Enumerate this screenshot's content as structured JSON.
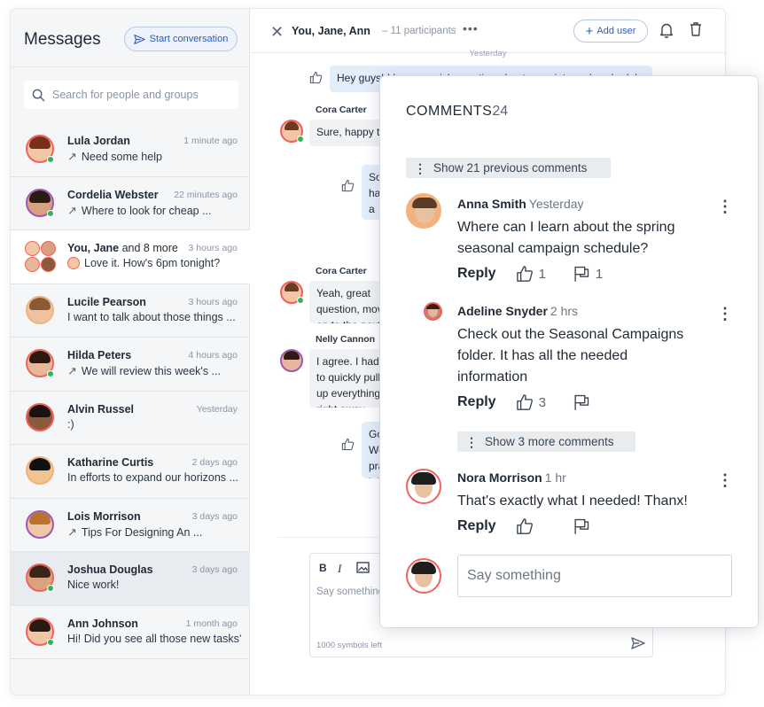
{
  "sidebar": {
    "title": "Messages",
    "start_button": "Start conversation",
    "search_placeholder": "Search for people and groups",
    "conversations": [
      {
        "name": "Lula Jordan",
        "time": "1 minute ago",
        "preview": "Need some help",
        "replied": true,
        "online": true
      },
      {
        "name": "Cordelia Webster",
        "time": "22 minutes ago",
        "preview": "Where to look for cheap ...",
        "replied": true,
        "online": true
      },
      {
        "name": "You, Jane",
        "name_more": " and 8 more",
        "time": "3 hours ago",
        "preview": "Love it. How's 6pm tonight?",
        "group": true
      },
      {
        "name": "Lucile Pearson",
        "time": "3 hours ago",
        "preview": "I want to talk about those things ..."
      },
      {
        "name": "Hilda Peters",
        "time": "4 hours ago",
        "preview": "We will review this week's ...",
        "replied": true,
        "online": true
      },
      {
        "name": "Alvin Russel",
        "time": "Yesterday",
        "preview": ":)"
      },
      {
        "name": "Katharine Curtis",
        "time": "2 days ago",
        "preview": "In efforts to expand our horizons ..."
      },
      {
        "name": "Lois Morrison",
        "time": "3 days ago",
        "preview": "Tips For Designing An ...",
        "replied": true
      },
      {
        "name": "Joshua Douglas",
        "time": "3 days ago",
        "preview": "Nice work!",
        "online": true
      },
      {
        "name": "Ann Johnson",
        "time": "1 month ago",
        "preview": "Hi! Did you see all those new tasks?",
        "online": true
      }
    ]
  },
  "chat": {
    "title": "You, Jane, Ann",
    "participants": "– 11 participants",
    "add_user": "Add user",
    "day": "Yesterday",
    "messages": [
      {
        "text": "Hey guys! I have a quick question about our winter sale schedule"
      },
      {
        "sender": "Cora Carter",
        "text": "Sure, happy to"
      },
      {
        "text": "So I have a question, thank you for getting back on the..."
      },
      {
        "sender": "Cora Carter",
        "text": "Yeah, great question, move on to the next step"
      },
      {
        "sender": "Nelly Cannon",
        "text": "I agree. I had to quickly pull up everything right away."
      },
      {
        "text": "Got it! We practice it if you..."
      }
    ],
    "compose_placeholder": "Say something",
    "symbols_left": "1000 symbols left",
    "format": {
      "bold": "B",
      "italic": "I"
    }
  },
  "comments": {
    "title": "COMMENTS",
    "count": "24",
    "show_previous": "Show 21 previous comments",
    "show_more": "Show 3 more comments",
    "reply_label": "Reply",
    "items": [
      {
        "name": "Anna Smith",
        "time": "Yesterday",
        "text_lines": [
          "Where can I learn about the spring",
          "seasonal campaign schedule?"
        ],
        "likes": "1",
        "flags": "1"
      },
      {
        "name": "Adeline Snyder",
        "time": "2 hrs",
        "text_lines": [
          "Check out the Seasonal Campaigns",
          "folder. It has all the needed",
          "information"
        ],
        "likes": "3",
        "flags": ""
      },
      {
        "name": "Nora Morrison",
        "time": "1 hr",
        "text_lines": [
          "That's exactly what I needed! Thanx!"
        ],
        "likes": "",
        "flags": ""
      }
    ],
    "input_placeholder": "Say something"
  },
  "colors": {
    "accent": "#2f5db3",
    "avatar_ring": "#f1625c",
    "online": "#2fb35b",
    "bubble": "#e3eefb"
  },
  "icons": [
    "search-icon",
    "send-icon",
    "close-icon",
    "more-icon",
    "plus-icon",
    "bell-icon",
    "trash-icon",
    "thumbs-up-icon",
    "flag-icon",
    "reply-arrow-icon",
    "image-icon"
  ]
}
